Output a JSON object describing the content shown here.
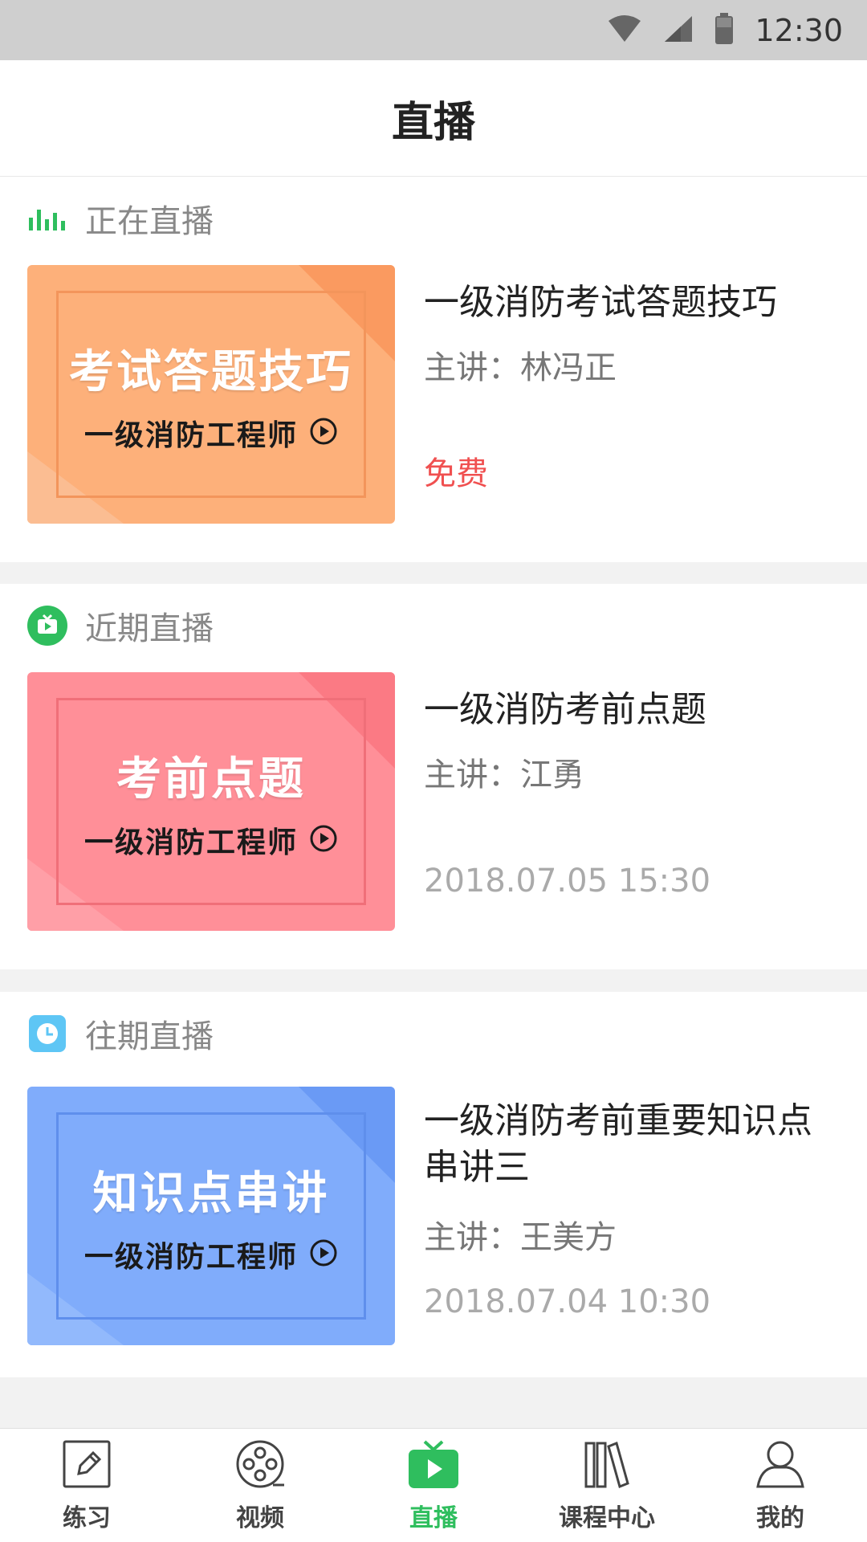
{
  "status_bar": {
    "time": "12:30"
  },
  "header": {
    "title": "直播"
  },
  "sections": [
    {
      "label": "正在直播",
      "icon": "live-bars-icon",
      "course": {
        "thumb_title": "考试答题技巧",
        "thumb_subtitle": "一级消防工程师",
        "title": "一级消防考试答题技巧",
        "lecturer": "主讲：林冯正",
        "price": "免费",
        "colors": {
          "base": "#fdb07a",
          "dark": "#fa9a60",
          "frame": "#f3955b"
        }
      }
    },
    {
      "label": "近期直播",
      "icon": "tv-icon",
      "course": {
        "thumb_title": "考前点题",
        "thumb_subtitle": "一级消防工程师",
        "title": "一级消防考前点题",
        "lecturer": "主讲：江勇",
        "time": "2018.07.05 15:30",
        "colors": {
          "base": "#ff8f98",
          "dark": "#fb7a84",
          "frame": "#f06f79"
        }
      }
    },
    {
      "label": "往期直播",
      "icon": "clock-icon",
      "course": {
        "thumb_title": "知识点串讲",
        "thumb_subtitle": "一级消防工程师",
        "title": "一级消防考前重要知识点串讲三",
        "lecturer": "主讲：王美方",
        "time": "2018.07.04 10:30",
        "colors": {
          "base": "#80acfb",
          "dark": "#6a9af5",
          "frame": "#5f8fec"
        }
      }
    }
  ],
  "nav": [
    {
      "label": "练习",
      "icon": "pencil-icon",
      "active": false
    },
    {
      "label": "视频",
      "icon": "film-reel-icon",
      "active": false
    },
    {
      "label": "直播",
      "icon": "live-tv-icon",
      "active": true
    },
    {
      "label": "课程中心",
      "icon": "books-icon",
      "active": false
    },
    {
      "label": "我的",
      "icon": "user-icon",
      "active": false
    }
  ],
  "colors": {
    "accent": "#2fbe5e",
    "price": "#f05050"
  }
}
